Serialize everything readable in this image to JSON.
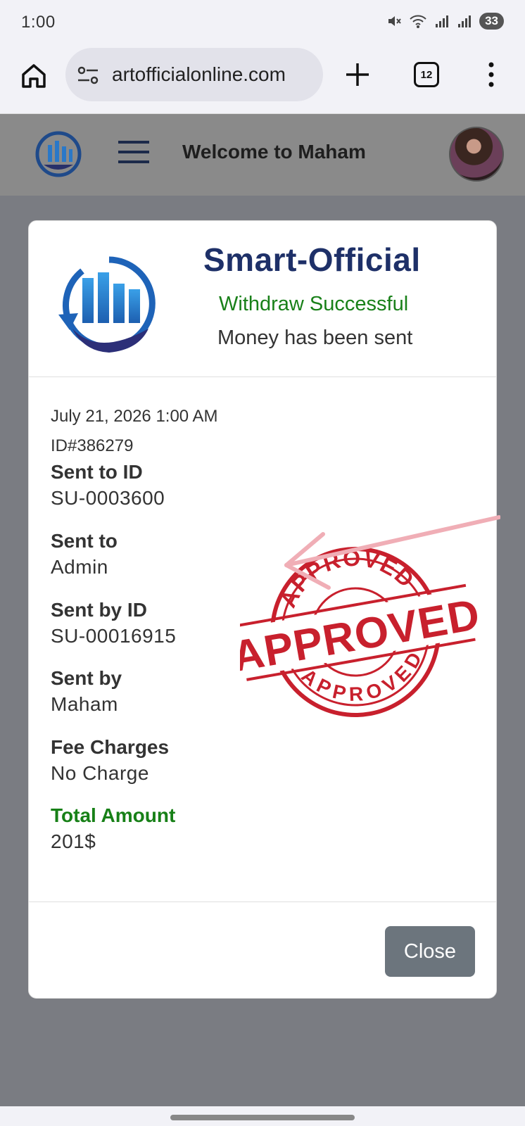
{
  "status": {
    "time": "1:00",
    "battery": "33"
  },
  "browser": {
    "url": "artofficialonline.com",
    "tab_count": "12"
  },
  "header": {
    "welcome": "Welcome to Maham"
  },
  "modal": {
    "brand": "Smart-Official",
    "status_text": "Withdraw Successful",
    "message": "Money has been sent",
    "date": "July 21, 2026 1:00 AM",
    "transaction_id": "ID#386279",
    "fields": [
      {
        "label": "Sent to ID",
        "value": "SU-0003600"
      },
      {
        "label": "Sent to",
        "value": "Admin"
      },
      {
        "label": "Sent by ID",
        "value": "SU-00016915"
      },
      {
        "label": "Sent by",
        "value": "Maham"
      },
      {
        "label": "Fee Charges",
        "value": "No Charge"
      },
      {
        "label": "Total Amount",
        "value": "201$"
      }
    ],
    "stamp": {
      "main": "APPROVED",
      "top_arc": "APPROVED",
      "bottom_arc": "APPROVED"
    },
    "close_label": "Close"
  },
  "colors": {
    "brand_navy": "#1e3068",
    "success_green": "#198019",
    "stamp_red": "#c8202d",
    "button_gray": "#6c757d"
  }
}
